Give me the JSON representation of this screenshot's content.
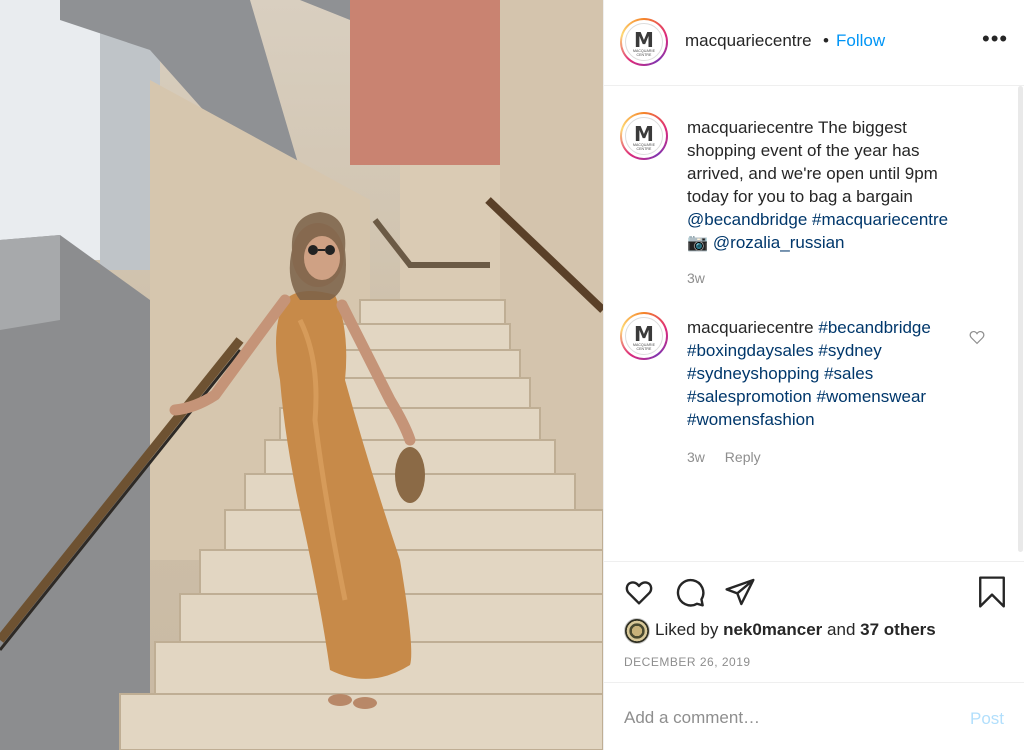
{
  "post": {
    "image_alt": "Woman in satin dress on stairs"
  },
  "header": {
    "avatar_initial": "M",
    "avatar_subtext": "MACQUARIE CENTRE",
    "username": "macquariecentre",
    "separator": "•",
    "follow_label": "Follow",
    "more_label": "•••"
  },
  "caption": {
    "username": "macquariecentre",
    "text": "The biggest shopping event of the year has arrived, and we're open until 9pm today for you to bag a bargain",
    "mention1": "@becandbridge",
    "hashtag1": "#macquariecentre",
    "camera": "📷",
    "mention2": "@rozalia_russian",
    "time": "3w"
  },
  "comment": {
    "username": "macquariecentre",
    "tags": [
      "#becandbridge",
      "#boxingdaysales",
      "#sydney",
      "#sydneyshopping",
      "#sales",
      "#salespromotion",
      "#womenswear",
      "#womensfashion"
    ],
    "time": "3w",
    "reply_label": "Reply"
  },
  "actions": {
    "like_icon": "heart-icon",
    "comment_icon": "comment-icon",
    "share_icon": "share-icon",
    "save_icon": "bookmark-icon"
  },
  "likes": {
    "prefix": "Liked by",
    "user": "nek0mancer",
    "middle": "and",
    "others": "37 others"
  },
  "date": "DECEMBER 26, 2019",
  "add_comment": {
    "placeholder": "Add a comment…",
    "post_label": "Post"
  },
  "colors": {
    "follow": "#0095f6",
    "link": "#00376b",
    "muted": "#8e8e8e",
    "post_disabled": "#b2dffc",
    "wall_accent": "#c97b63"
  }
}
